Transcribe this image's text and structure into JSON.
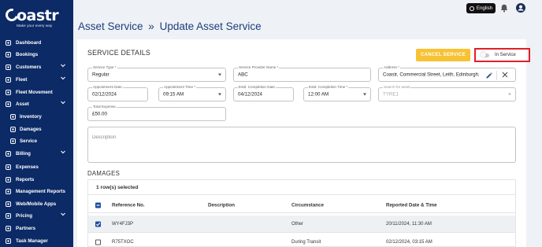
{
  "brand": {
    "name": "oastr",
    "tagline": "Make your every way"
  },
  "sidebar": {
    "items": [
      {
        "label": "Dashboard",
        "icon": "dashboard-icon",
        "chevron": false,
        "sub": false
      },
      {
        "label": "Bookings",
        "icon": "bookings-icon",
        "chevron": false,
        "sub": false
      },
      {
        "label": "Customers",
        "icon": "customers-icon",
        "chevron": true,
        "sub": false
      },
      {
        "label": "Fleet",
        "icon": "fleet-car-icon",
        "chevron": true,
        "sub": false
      },
      {
        "label": "Fleet Movement",
        "icon": "fleet-movement-icon",
        "chevron": false,
        "sub": false
      },
      {
        "label": "Asset",
        "icon": "asset-icon",
        "chevron": true,
        "sub": false
      },
      {
        "label": "Inventory",
        "icon": "inventory-icon",
        "chevron": false,
        "sub": true
      },
      {
        "label": "Damages",
        "icon": "damages-warning-icon",
        "chevron": false,
        "sub": true
      },
      {
        "label": "Service",
        "icon": "service-wrench-icon",
        "chevron": false,
        "sub": true
      },
      {
        "label": "Billing",
        "icon": "billing-icon",
        "chevron": true,
        "sub": false
      },
      {
        "label": "Expenses",
        "icon": "expenses-icon",
        "chevron": false,
        "sub": false
      },
      {
        "label": "Reports",
        "icon": "reports-icon",
        "chevron": false,
        "sub": false
      },
      {
        "label": "Management Reports",
        "icon": "management-reports-icon",
        "chevron": false,
        "sub": false
      },
      {
        "label": "Web/Mobile Apps",
        "icon": "apps-globe-icon",
        "chevron": false,
        "sub": false
      },
      {
        "label": "Pricing",
        "icon": "pricing-tag-icon",
        "chevron": true,
        "sub": false
      },
      {
        "label": "Partners",
        "icon": "partners-icon",
        "chevron": false,
        "sub": false
      },
      {
        "label": "Task Manager",
        "icon": "task-manager-icon",
        "chevron": false,
        "sub": false
      }
    ]
  },
  "topbar": {
    "language": "English"
  },
  "page": {
    "title_parent": "Asset Service",
    "title_separator": "»",
    "title_current": "Update Asset Service"
  },
  "service_details": {
    "title": "SERVICE DETAILS",
    "cancel_button": "CANCEL SERVICE",
    "status_toggle_label": "In Service",
    "status_toggle_on": false,
    "fields": {
      "service_type": {
        "label": "Service Type *",
        "value": "Regular"
      },
      "provider_name": {
        "label": "Service Provider Name *",
        "value": "ABC"
      },
      "address": {
        "label": "Address *",
        "value": "Coastr, Commercial Street, Leith, Edinburgh, UK"
      },
      "appointment_date": {
        "label": "Appointment Date",
        "value": "02/12/2024"
      },
      "appointment_time": {
        "label": "Appointment Time *",
        "value": "09:15 AM"
      },
      "completion_date": {
        "label": "Estd. Completion Date",
        "value": "04/12/2024"
      },
      "completion_time": {
        "label": "Estd. Completion Time *",
        "value": "12:00 AM"
      },
      "asset_search": {
        "label": "Search for asset",
        "value": "TYRE1"
      },
      "total_expense": {
        "label": "Total Expense",
        "value": "£50.00"
      },
      "description": {
        "placeholder": "Description"
      }
    }
  },
  "damages": {
    "title": "DAMAGES",
    "selection_text": "1 row(s) selected",
    "columns": [
      "Reference No.",
      "Description",
      "Circumstance",
      "Reported Date & Time"
    ],
    "rows": [
      {
        "ref": "WY4FJ3P",
        "description": "",
        "circumstance": "Other",
        "reported": "20/11/2024, 11:30 AM",
        "selected": true
      },
      {
        "ref": "R75TXOC",
        "description": "",
        "circumstance": "During Transit",
        "reported": "02/12/2024, 03:15 AM",
        "selected": false
      }
    ]
  },
  "colors": {
    "sidebar": "#0b2a66",
    "accent": "#f7c234",
    "highlight": "#e0202a",
    "title": "#1f3d7a",
    "checkbox": "#1f4fa0"
  }
}
